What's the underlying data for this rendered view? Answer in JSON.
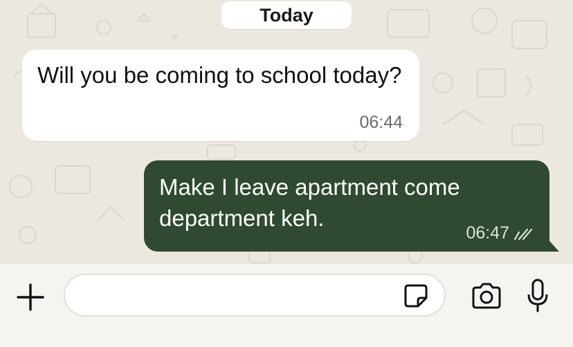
{
  "chat": {
    "date_chip": "Today",
    "messages": [
      {
        "direction": "incoming",
        "text": "Will you be coming to school today?",
        "time": "06:44"
      },
      {
        "direction": "outgoing",
        "text": "Make I leave apartment come department keh.",
        "time": "06:47",
        "status_icon": "double-check-read-icon"
      }
    ]
  },
  "input_bar": {
    "placeholder": "",
    "icons": [
      "plus-icon",
      "sticker-icon",
      "camera-icon",
      "microphone-icon"
    ]
  },
  "colors": {
    "outgoing_bubble": "#2f4a30",
    "incoming_bubble": "#ffffff",
    "chat_background": "#ece8df"
  }
}
